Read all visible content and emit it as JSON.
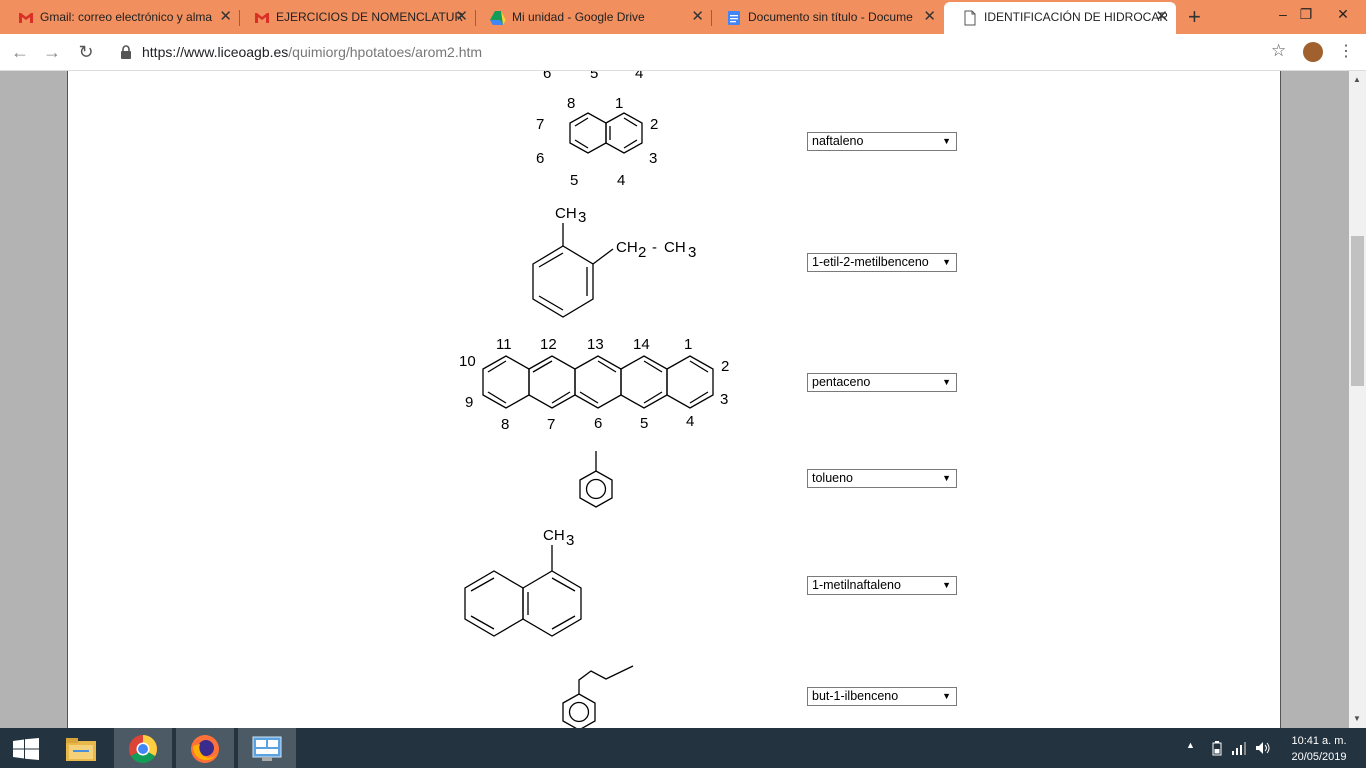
{
  "tabs": [
    {
      "label": "Gmail: correo electrónico y alma",
      "favicon": "gmail-icon"
    },
    {
      "label": "EJERCICIOS DE NOMENCLATUR",
      "favicon": "gmail-icon"
    },
    {
      "label": "Mi unidad - Google Drive",
      "favicon": "drive-icon"
    },
    {
      "label": "Documento sin título - Docume",
      "favicon": "docs-icon"
    },
    {
      "label": "IDENTIFICACIÓN DE HIDROCAR",
      "favicon": "page-icon"
    }
  ],
  "address": {
    "host": "https://www.liceoagb.es",
    "path": "/quimiorg/hpotatoes/arom2.htm"
  },
  "molecules": {
    "top_partial_labels": [
      "6",
      "5",
      "4"
    ],
    "naphthalene_labels": [
      "8",
      "1",
      "7",
      "2",
      "6",
      "3",
      "5",
      "4"
    ],
    "etil_ch3": "CH",
    "etil_ch2": "CH",
    "etil_ch3b": "CH",
    "sub3": "3",
    "sub2": "2",
    "dash": "-",
    "pentacene_labels": [
      "11",
      "12",
      "13",
      "14",
      "1",
      "10",
      "2",
      "9",
      "3",
      "8",
      "7",
      "6",
      "5",
      "4"
    ],
    "methylnaph_ch": "CH",
    "methylnaph_sub": "3"
  },
  "answers": [
    "naftaleno",
    "1-etil-2-metilbenceno",
    "pentaceno",
    "tolueno",
    "1-metilnaftaleno",
    "but-1-ilbenceno"
  ],
  "dropdown_arrow": "▼",
  "taskbar": {
    "time": "10:41 a. m.",
    "date": "20/05/2019"
  }
}
